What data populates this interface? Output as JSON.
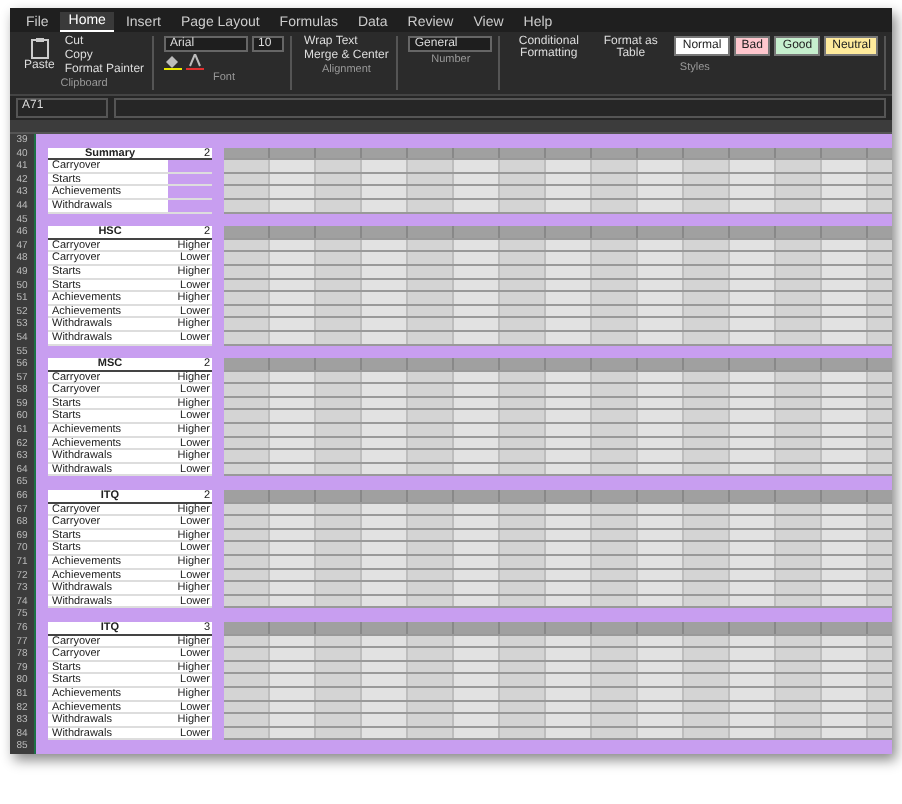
{
  "ribbon": {
    "tabs": [
      {
        "label": "File",
        "selected": false
      },
      {
        "label": "Home",
        "selected": true
      },
      {
        "label": "Insert",
        "selected": false
      },
      {
        "label": "Page Layout",
        "selected": false
      },
      {
        "label": "Formulas",
        "selected": false
      },
      {
        "label": "Data",
        "selected": false
      },
      {
        "label": "Review",
        "selected": false
      },
      {
        "label": "View",
        "selected": false
      },
      {
        "label": "Help",
        "selected": false
      }
    ]
  },
  "clipboard": {
    "paste": "Paste",
    "cut": "Cut",
    "copy": "Copy",
    "painter": "Format Painter",
    "label": "Clipboard"
  },
  "font": {
    "name": "Arial",
    "size": "10",
    "label": "Font"
  },
  "alignment": {
    "wrap": "Wrap Text",
    "merge": "Merge & Center",
    "label": "Alignment"
  },
  "number": {
    "format": "General",
    "label": "Number"
  },
  "styles": {
    "conditional": "Conditional Formatting",
    "table": "Format as Table",
    "label": "Styles",
    "cells": [
      {
        "label": "Normal",
        "color": "#ffffff"
      },
      {
        "label": "Bad",
        "color": "#ffc7ce"
      },
      {
        "label": "Good",
        "color": "#c6efce"
      },
      {
        "label": "Neutral",
        "color": "#ffeb9c"
      }
    ]
  },
  "formula_bar": {
    "name_box": "A71"
  },
  "rows": [
    {
      "row": "39",
      "kind": "gap"
    },
    {
      "row": "40",
      "kind": "header",
      "label": "Summary",
      "value": "2"
    },
    {
      "row": "41",
      "kind": "item",
      "label": "Carryover"
    },
    {
      "row": "42",
      "kind": "item",
      "label": "Starts"
    },
    {
      "row": "43",
      "kind": "item",
      "label": "Achievements"
    },
    {
      "row": "44",
      "kind": "item",
      "label": "Withdrawals"
    },
    {
      "row": "45",
      "kind": "gap"
    },
    {
      "row": "46",
      "kind": "header",
      "label": "HSC",
      "value": "2"
    },
    {
      "row": "47",
      "kind": "item",
      "label": "Carryover",
      "value": "Higher"
    },
    {
      "row": "48",
      "kind": "item",
      "label": "Carryover",
      "value": "Lower"
    },
    {
      "row": "49",
      "kind": "item",
      "label": "Starts",
      "value": "Higher"
    },
    {
      "row": "50",
      "kind": "item",
      "label": "Starts",
      "value": "Lower"
    },
    {
      "row": "51",
      "kind": "item",
      "label": "Achievements",
      "value": "Higher"
    },
    {
      "row": "52",
      "kind": "item",
      "label": "Achievements",
      "value": "Lower"
    },
    {
      "row": "53",
      "kind": "item",
      "label": "Withdrawals",
      "value": "Higher"
    },
    {
      "row": "54",
      "kind": "item",
      "label": "Withdrawals",
      "value": "Lower"
    },
    {
      "row": "55",
      "kind": "gap"
    },
    {
      "row": "56",
      "kind": "header",
      "label": "MSC",
      "value": "2"
    },
    {
      "row": "57",
      "kind": "item",
      "label": "Carryover",
      "value": "Higher"
    },
    {
      "row": "58",
      "kind": "item",
      "label": "Carryover",
      "value": "Lower"
    },
    {
      "row": "59",
      "kind": "item",
      "label": "Starts",
      "value": "Higher"
    },
    {
      "row": "60",
      "kind": "item",
      "label": "Starts",
      "value": "Lower"
    },
    {
      "row": "61",
      "kind": "item",
      "label": "Achievements",
      "value": "Higher"
    },
    {
      "row": "62",
      "kind": "item",
      "label": "Achievements",
      "value": "Lower"
    },
    {
      "row": "63",
      "kind": "item",
      "label": "Withdrawals",
      "value": "Higher"
    },
    {
      "row": "64",
      "kind": "item",
      "label": "Withdrawals",
      "value": "Lower"
    },
    {
      "row": "65",
      "kind": "gap"
    },
    {
      "row": "66",
      "kind": "header",
      "label": "ITQ",
      "value": "2"
    },
    {
      "row": "67",
      "kind": "item",
      "label": "Carryover",
      "value": "Higher"
    },
    {
      "row": "68",
      "kind": "item",
      "label": "Carryover",
      "value": "Lower"
    },
    {
      "row": "69",
      "kind": "item",
      "label": "Starts",
      "value": "Higher"
    },
    {
      "row": "70",
      "kind": "item",
      "label": "Starts",
      "value": "Lower"
    },
    {
      "row": "71",
      "kind": "item",
      "label": "Achievements",
      "value": "Higher"
    },
    {
      "row": "72",
      "kind": "item",
      "label": "Achievements",
      "value": "Lower"
    },
    {
      "row": "73",
      "kind": "item",
      "label": "Withdrawals",
      "value": "Higher"
    },
    {
      "row": "74",
      "kind": "item",
      "label": "Withdrawals",
      "value": "Lower"
    },
    {
      "row": "75",
      "kind": "gap"
    },
    {
      "row": "76",
      "kind": "header",
      "label": "ITQ",
      "value": "3"
    },
    {
      "row": "77",
      "kind": "item",
      "label": "Carryover",
      "value": "Higher"
    },
    {
      "row": "78",
      "kind": "item",
      "label": "Carryover",
      "value": "Lower"
    },
    {
      "row": "79",
      "kind": "item",
      "label": "Starts",
      "value": "Higher"
    },
    {
      "row": "80",
      "kind": "item",
      "label": "Starts",
      "value": "Lower"
    },
    {
      "row": "81",
      "kind": "item",
      "label": "Achievements",
      "value": "Higher"
    },
    {
      "row": "82",
      "kind": "item",
      "label": "Achievements",
      "value": "Lower"
    },
    {
      "row": "83",
      "kind": "item",
      "label": "Withdrawals",
      "value": "Higher"
    },
    {
      "row": "84",
      "kind": "item",
      "label": "Withdrawals",
      "value": "Lower"
    },
    {
      "row": "85",
      "kind": "gap"
    }
  ]
}
